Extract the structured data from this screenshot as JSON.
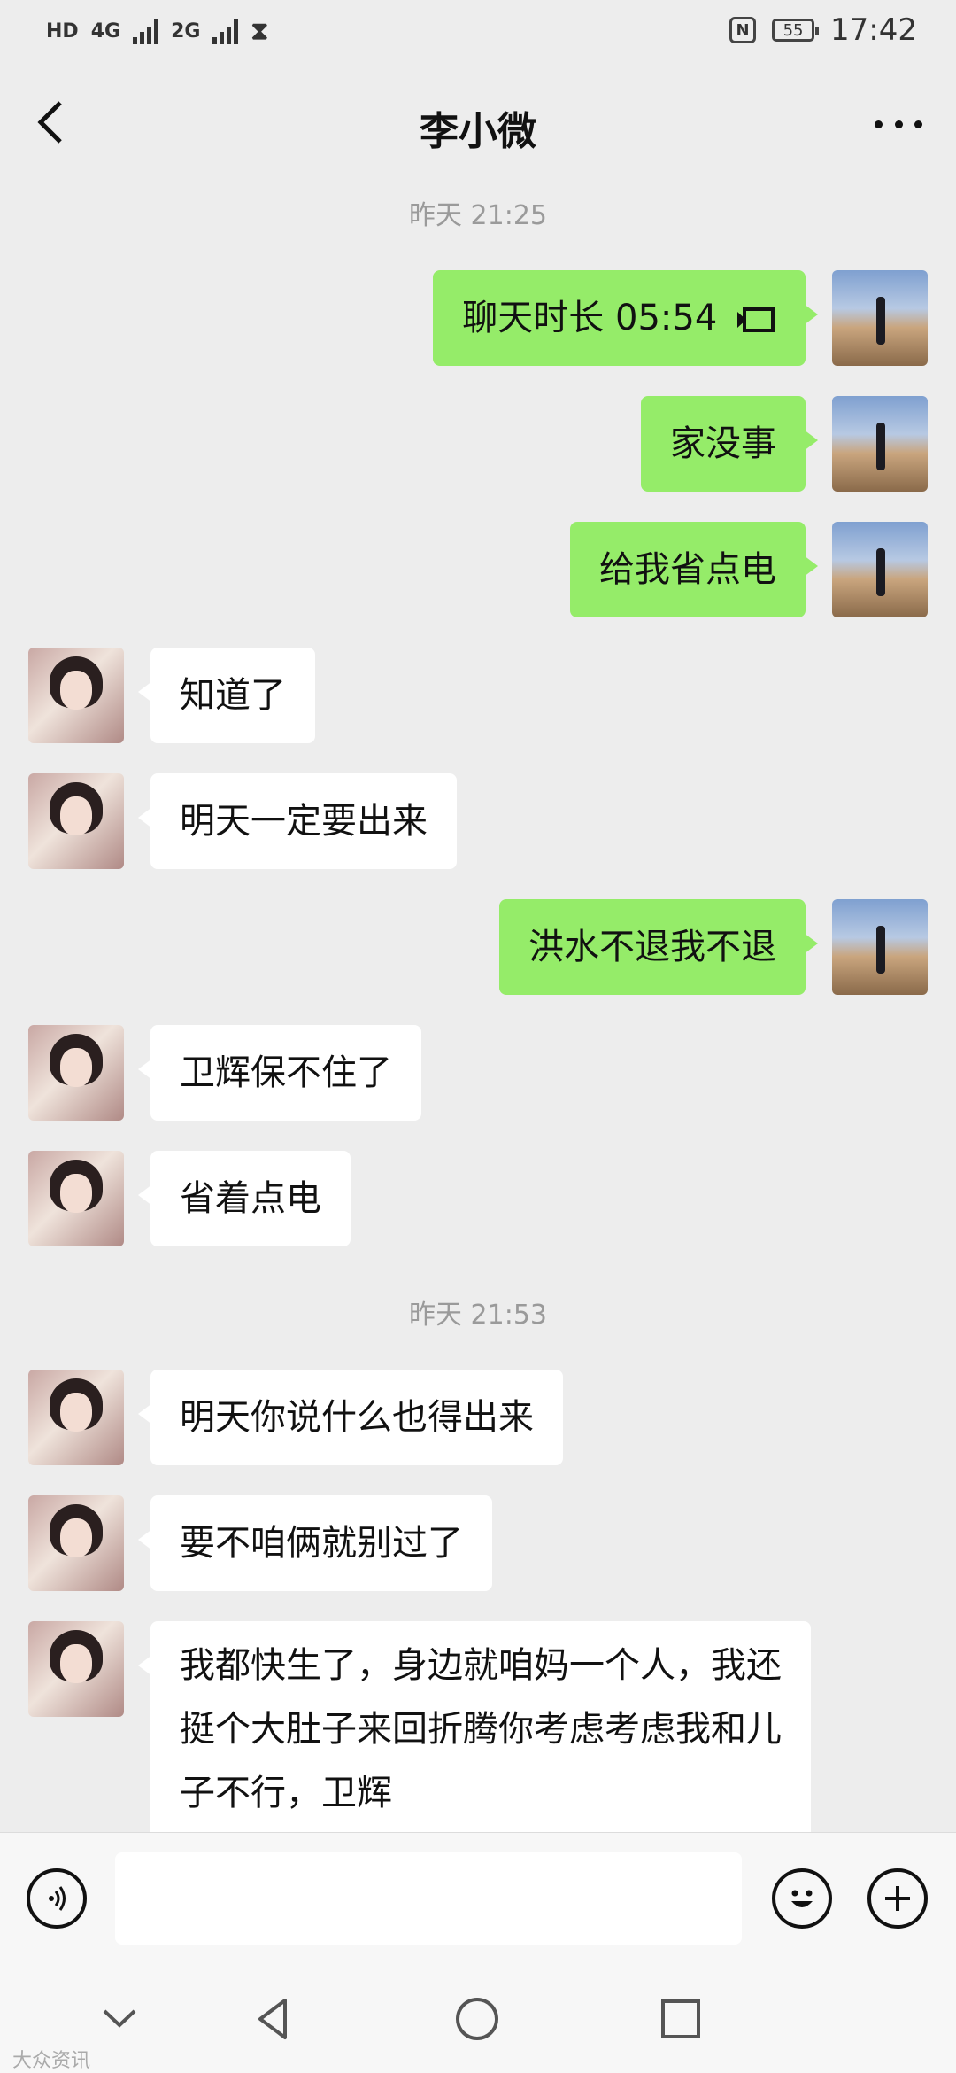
{
  "status_bar": {
    "left_labels": [
      "HD",
      "4G",
      "2G"
    ],
    "battery": "55",
    "nfc": "N",
    "time": "17:42"
  },
  "header": {
    "title": "李小微"
  },
  "timestamps": [
    "昨天 21:25",
    "昨天 21:53"
  ],
  "messages": [
    {
      "side": "me",
      "text": "聊天时长 05:54",
      "icon": "video-call-icon"
    },
    {
      "side": "me",
      "text": "家没事"
    },
    {
      "side": "me",
      "text": "给我省点电"
    },
    {
      "side": "her",
      "text": "知道了"
    },
    {
      "side": "her",
      "text": "明天一定要出来"
    },
    {
      "side": "me",
      "text": "洪水不退我不退"
    },
    {
      "side": "her",
      "text": "卫辉保不住了"
    },
    {
      "side": "her",
      "text": "省着点电"
    },
    {
      "side": "her",
      "text": "明天你说什么也得出来"
    },
    {
      "side": "her",
      "text": "要不咱俩就别过了"
    },
    {
      "side": "her",
      "text": "我都快生了，身边就咱妈一个人，我还挺个大肚子来回折腾你考虑考虑我和儿子不行，卫辉"
    }
  ],
  "input_bar": {
    "icons": [
      "voice-icon",
      "emoji-icon",
      "plus-icon"
    ]
  },
  "nav_bar": {
    "icons": [
      "chevron-down-icon",
      "back-triangle-icon",
      "home-circle-icon",
      "recents-square-icon"
    ]
  },
  "watermark": "大众资讯"
}
